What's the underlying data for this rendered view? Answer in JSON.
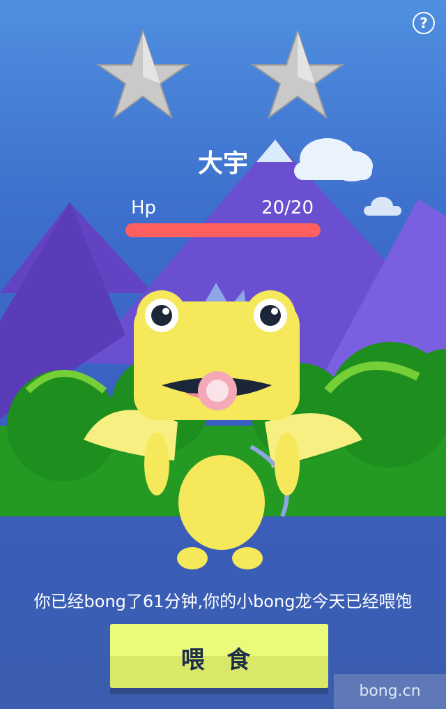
{
  "help": {
    "icon": "question-icon",
    "glyph": "?"
  },
  "stars": {
    "count": 2,
    "color": "#c8c8c8"
  },
  "pet": {
    "name": "大宇"
  },
  "hp": {
    "label": "Hp",
    "value": "20/20",
    "current": 20,
    "max": 20,
    "bar_color": "#ff5f5f"
  },
  "status_text": "你已经bong了61分钟,你的小bong龙今天已经喂饱",
  "feed_button": {
    "label": "喂 食"
  },
  "watermark": "bong.cn",
  "colors": {
    "sky": "#4f8fe0",
    "mountain": "#6a4fd0",
    "bush": "#2f9e2a",
    "dragon": "#f5e85a",
    "button": "#eafb7c"
  }
}
